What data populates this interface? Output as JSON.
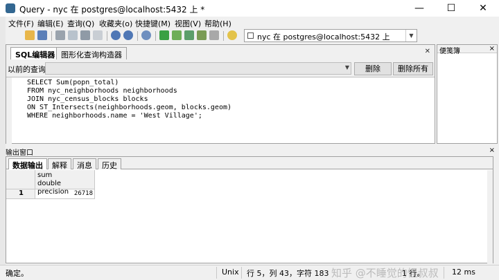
{
  "window": {
    "title": "Query - nyc 在  postgres@localhost:5432 上 *",
    "minimize": "—",
    "maximize": "☐",
    "close": "✕"
  },
  "menu": [
    "文件(F)",
    "编辑(E)",
    "查询(Q)",
    "收藏夹(o)",
    "快捷键(M)",
    "视图(V)",
    "帮助(H)"
  ],
  "connection": {
    "value": "nyc 在  postgres@localhost:5432 上"
  },
  "editor": {
    "tabs": [
      "SQL编辑器",
      "图形化查询构造器"
    ],
    "previous_query_label": "以前的查询",
    "delete_button": "删除",
    "delete_all_button": "删除所有",
    "sql_lines": [
      "SELECT Sum(popn_total)",
      "FROM nyc_neighborhoods neighborhoods",
      "JOIN nyc_census_blocks blocks",
      "ON ST_Intersects(neighborhoods.geom, blocks.geom)",
      "WHERE neighborhoods.name = 'West Village';"
    ]
  },
  "scratch_pad": {
    "title": "便笺簿",
    "close": "×"
  },
  "output": {
    "title": "输出窗口",
    "close": "×",
    "tabs": [
      "数据输出",
      "解释",
      "消息",
      "历史"
    ],
    "columns": [
      {
        "name": "sum",
        "type": "double precision"
      }
    ],
    "rows": [
      {
        "num": "1",
        "value": "26718"
      }
    ]
  },
  "status": {
    "message": "确定。",
    "line_ending": "Unix",
    "position": "行 5，列 43，字符 183",
    "rows": "1 行。",
    "time": "12 ms",
    "watermark": "知乎 @不睡觉的怪叔叔"
  },
  "colors": {
    "tab_active_bg": "#ffffff",
    "chrome_bg": "#f0f0f0",
    "app_icon": "#336791"
  }
}
